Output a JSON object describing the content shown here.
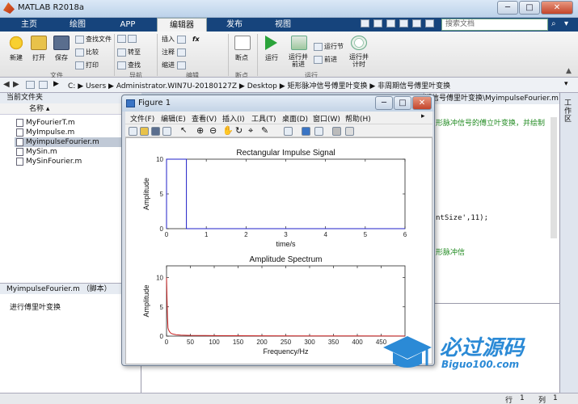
{
  "window": {
    "title": "MATLAB R2018a"
  },
  "tabs": [
    {
      "label": "主页"
    },
    {
      "label": "绘图"
    },
    {
      "label": "APP"
    },
    {
      "label": "编辑器"
    },
    {
      "label": "发布"
    },
    {
      "label": "视图"
    }
  ],
  "search": {
    "placeholder": "搜索文档"
  },
  "ribbon": {
    "file": {
      "new": "新建",
      "open": "打开",
      "save": "保存",
      "find_files": "查找文件",
      "compare": "比较",
      "print": "打印",
      "group": "文件"
    },
    "nav": {
      "goto": "转至",
      "find": "查找",
      "group": "导航"
    },
    "edit": {
      "insert": "插入",
      "comment": "注释",
      "indent": "缩进",
      "group": "编辑"
    },
    "breakpoints": {
      "label": "断点",
      "group": "断点"
    },
    "run": {
      "run": "运行",
      "run_advance": "运行并\n前进",
      "run_section": "运行节",
      "advance": "前进",
      "run_time": "运行并\n计时",
      "group": "运行"
    }
  },
  "address": {
    "segments": [
      "C:",
      "Users",
      "Administrator.WIN7U-20180127Z",
      "Desktop",
      "矩形脉冲信号傅里叶变换",
      "非周期信号傅里叶变换"
    ]
  },
  "left_pane": {
    "title": "当前文件夹",
    "column": "名称",
    "files": [
      "MyFourierT.m",
      "MyImpulse.m",
      "MyimpulseFourier.m",
      "MySin.m",
      "MySinFourier.m"
    ],
    "selected_index": 2,
    "detail_title": "MyimpulseFourier.m （脚本）",
    "detail_text": "进行傅里叶变换"
  },
  "editor": {
    "tab": "期信号傅里叶变换\\MyimpulseFourier.m",
    "comment1": "形脉冲信号的傅立叶变换，并绘制",
    "code_line": "ntSize',11);",
    "comment2": "形脉冲信"
  },
  "workspace_strip": "工作区",
  "status": {
    "row_label": "行",
    "row": "1",
    "col_label": "列",
    "col": "1"
  },
  "figure": {
    "title": "Figure 1",
    "menus": [
      "文件(F)",
      "编辑(E)",
      "查看(V)",
      "插入(I)",
      "工具(T)",
      "桌面(D)",
      "窗口(W)",
      "帮助(H)"
    ]
  },
  "watermark": {
    "brand": "必过源码",
    "url": "Biguo100.com"
  },
  "colors": {
    "tabbar": "#16447c",
    "series1": "#1f1fc8",
    "series2": "#c81e1e",
    "accent": "#2b8ad6"
  },
  "chart_data": [
    {
      "type": "line",
      "title": "Rectangular Impulse Signal",
      "xlabel": "time/s",
      "ylabel": "Amplitude",
      "xlim": [
        0,
        6
      ],
      "ylim": [
        0,
        10
      ],
      "xticks": [
        0,
        1,
        2,
        3,
        4,
        5,
        6
      ],
      "yticks": [
        0,
        5,
        10
      ],
      "grid": false,
      "series": [
        {
          "x": [
            0,
            0,
            0.5,
            0.5,
            6
          ],
          "y": [
            0,
            10,
            10,
            0,
            0
          ]
        }
      ]
    },
    {
      "type": "line",
      "title": "Amplitude Spectrum",
      "xlabel": "Frequency/Hz",
      "ylabel": "Amplitude",
      "xlim": [
        0,
        500
      ],
      "ylim": [
        0,
        12
      ],
      "xticks": [
        0,
        50,
        100,
        150,
        200,
        250,
        300,
        350,
        400,
        450
      ],
      "yticks": [
        0,
        5,
        10
      ],
      "grid": false,
      "series": [
        {
          "x": [
            0,
            1,
            2,
            3,
            4,
            6,
            8,
            10,
            14,
            20,
            30,
            50,
            100,
            200,
            300,
            400,
            500
          ],
          "y": [
            10,
            6.4,
            3.2,
            1.4,
            1.1,
            0.8,
            0.6,
            0.45,
            0.35,
            0.25,
            0.18,
            0.12,
            0.08,
            0.05,
            0.04,
            0.03,
            0.02
          ]
        }
      ]
    }
  ]
}
